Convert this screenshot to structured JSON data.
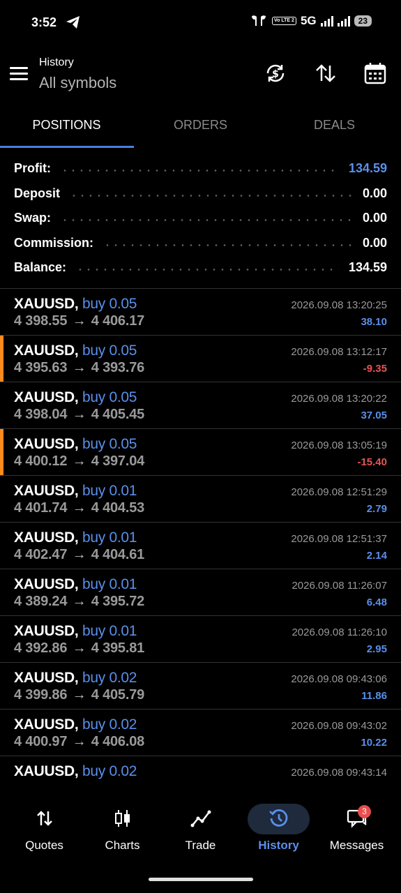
{
  "status_bar": {
    "time": "3:52",
    "network": "5G",
    "volte_label": "Vo LTE 2",
    "battery": "23"
  },
  "header": {
    "title": "History",
    "subtitle": "All symbols",
    "icons": [
      "currency-refresh-icon",
      "sort-icon",
      "calendar-icon"
    ]
  },
  "tabs": [
    "POSITIONS",
    "ORDERS",
    "DEALS"
  ],
  "active_tab": "POSITIONS",
  "summary": [
    {
      "label": "Profit:",
      "value": "134.59",
      "color": "#5a8fea"
    },
    {
      "label": "Deposit",
      "value": "0.00"
    },
    {
      "label": "Swap:",
      "value": "0.00"
    },
    {
      "label": "Commission:",
      "value": "0.00"
    },
    {
      "label": "Balance:",
      "value": "134.59"
    }
  ],
  "positions": [
    {
      "symbol": "XAUUSD,",
      "direction": "buy 0.05",
      "open": "4 398.55",
      "close": "4 406.17",
      "time": "2026.09.08 13:20:25",
      "profit": "38.10",
      "loss": false
    },
    {
      "symbol": "XAUUSD,",
      "direction": "buy 0.05",
      "open": "4 395.63",
      "close": "4 393.76",
      "time": "2026.09.08 13:12:17",
      "profit": "-9.35",
      "loss": true
    },
    {
      "symbol": "XAUUSD,",
      "direction": "buy 0.05",
      "open": "4 398.04",
      "close": "4 405.45",
      "time": "2026.09.08 13:20:22",
      "profit": "37.05",
      "loss": false
    },
    {
      "symbol": "XAUUSD,",
      "direction": "buy 0.05",
      "open": "4 400.12",
      "close": "4 397.04",
      "time": "2026.09.08 13:05:19",
      "profit": "-15.40",
      "loss": true
    },
    {
      "symbol": "XAUUSD,",
      "direction": "buy 0.01",
      "open": "4 401.74",
      "close": "4 404.53",
      "time": "2026.09.08 12:51:29",
      "profit": "2.79",
      "loss": false
    },
    {
      "symbol": "XAUUSD,",
      "direction": "buy 0.01",
      "open": "4 402.47",
      "close": "4 404.61",
      "time": "2026.09.08 12:51:37",
      "profit": "2.14",
      "loss": false
    },
    {
      "symbol": "XAUUSD,",
      "direction": "buy 0.01",
      "open": "4 389.24",
      "close": "4 395.72",
      "time": "2026.09.08 11:26:07",
      "profit": "6.48",
      "loss": false
    },
    {
      "symbol": "XAUUSD,",
      "direction": "buy 0.01",
      "open": "4 392.86",
      "close": "4 395.81",
      "time": "2026.09.08 11:26:10",
      "profit": "2.95",
      "loss": false
    },
    {
      "symbol": "XAUUSD,",
      "direction": "buy 0.02",
      "open": "4 399.86",
      "close": "4 405.79",
      "time": "2026.09.08 09:43:06",
      "profit": "11.86",
      "loss": false
    },
    {
      "symbol": "XAUUSD,",
      "direction": "buy 0.02",
      "open": "4 400.97",
      "close": "4 406.08",
      "time": "2026.09.08 09:43:02",
      "profit": "10.22",
      "loss": false
    },
    {
      "symbol": "XAUUSD,",
      "direction": "buy 0.02",
      "open": "",
      "close": "",
      "time": "2026.09.08 09:43:14",
      "profit": "",
      "loss": false
    }
  ],
  "arrow": "→",
  "bottom_nav": [
    {
      "label": "Quotes",
      "icon": "quotes-icon"
    },
    {
      "label": "Charts",
      "icon": "charts-icon"
    },
    {
      "label": "Trade",
      "icon": "trade-icon"
    },
    {
      "label": "History",
      "icon": "history-icon",
      "active": true
    },
    {
      "label": "Messages",
      "icon": "messages-icon",
      "badge": "3"
    }
  ],
  "colors": {
    "accent": "#5a8fea",
    "loss": "#e85454",
    "loss_marker": "#ff8a1e"
  }
}
